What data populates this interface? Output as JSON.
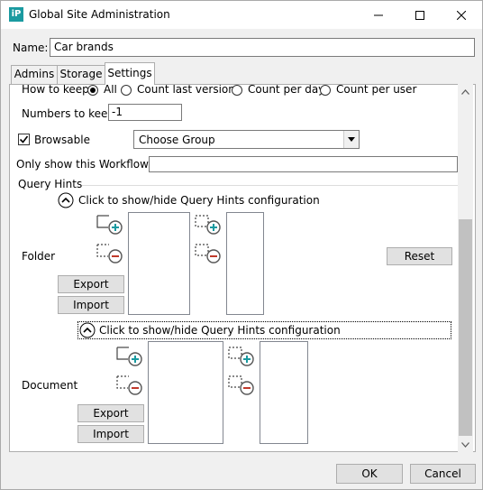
{
  "window": {
    "title": "Global Site Administration",
    "app_icon": "iP"
  },
  "name": {
    "label": "Name:",
    "value": "Car brands"
  },
  "tabs": [
    {
      "label": "Admins"
    },
    {
      "label": "Storage"
    },
    {
      "label": "Settings"
    }
  ],
  "settings": {
    "how_to_keep": {
      "label": "How to keep",
      "options": [
        "All",
        "Count last versions",
        "Count per day",
        "Count per user"
      ],
      "selected": "All"
    },
    "numbers_to_keep": {
      "label": "Numbers to keep",
      "value": "-1"
    },
    "browsable": {
      "label": "Browsable",
      "checked": true
    },
    "group_select": {
      "value": "Choose Group"
    },
    "only_show_workflow": {
      "label": "Only show this Workflow's:",
      "value": ""
    },
    "query_hints": {
      "title": "Query Hints",
      "folder": {
        "toggle": "Click to show/hide Query Hints configuration",
        "label": "Folder",
        "export": "Export",
        "import": "Import",
        "reset": "Reset"
      },
      "document": {
        "toggle": "Click to show/hide Query Hints configuration",
        "label": "Document",
        "export": "Export",
        "import": "Import"
      }
    }
  },
  "footer": {
    "ok": "OK",
    "cancel": "Cancel"
  },
  "colors": {
    "add": "#1a9aa0",
    "remove": "#c0392b"
  },
  "icons": [
    "app-icon",
    "minimize-icon",
    "maximize-icon",
    "close-icon",
    "checkmark-icon",
    "dropdown-arrow-icon",
    "chevron-up-circle-icon",
    "add-group-icon",
    "add-item-icon",
    "remove-group-icon",
    "remove-item-icon",
    "scroll-up-icon",
    "scroll-down-icon"
  ]
}
